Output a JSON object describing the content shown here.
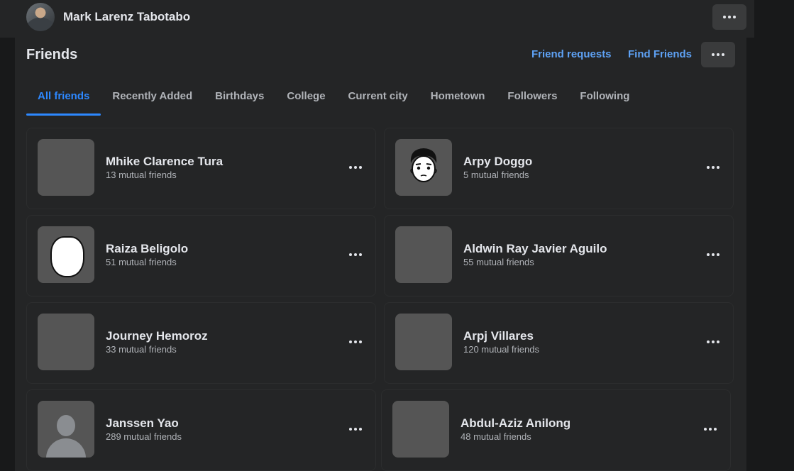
{
  "profile": {
    "name": "Mark Larenz Tabotabo",
    "avatar_icon": "profile-photo"
  },
  "header": {
    "title": "Friends",
    "friend_requests_label": "Friend requests",
    "find_friends_label": "Find Friends",
    "more_icon": "more-horizontal-icon"
  },
  "tabs": [
    {
      "label": "All friends",
      "active": true
    },
    {
      "label": "Recently Added",
      "active": false
    },
    {
      "label": "Birthdays",
      "active": false
    },
    {
      "label": "College",
      "active": false
    },
    {
      "label": "Current city",
      "active": false
    },
    {
      "label": "Hometown",
      "active": false
    },
    {
      "label": "Followers",
      "active": false
    },
    {
      "label": "Following",
      "active": false
    }
  ],
  "friends": [
    {
      "name": "Mhike Clarence Tura",
      "mutual": "13 mutual friends"
    },
    {
      "name": "Arpy Doggo",
      "mutual": "5 mutual friends"
    },
    {
      "name": "Raiza Beligolo",
      "mutual": "51 mutual friends"
    },
    {
      "name": "Aldwin Ray Javier Aguilo",
      "mutual": "55 mutual friends"
    },
    {
      "name": "Journey Hemoroz",
      "mutual": "33 mutual friends"
    },
    {
      "name": "Arpj Villares",
      "mutual": "120 mutual friends"
    },
    {
      "name": "Janssen Yao",
      "mutual": "289 mutual friends"
    },
    {
      "name": "Abdul-Aziz Anilong",
      "mutual": "48 mutual friends"
    }
  ],
  "colors": {
    "accent": "#2d88ff",
    "link": "#5ea2f5",
    "surface": "#242526",
    "background": "#18191a"
  }
}
